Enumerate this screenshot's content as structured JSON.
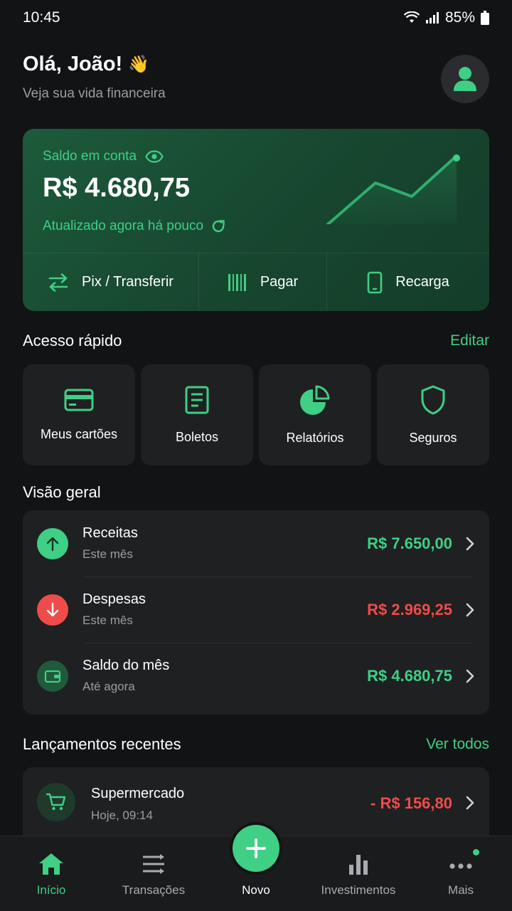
{
  "status_bar": {
    "time": "10:45",
    "battery": "85%"
  },
  "header": {
    "greeting": "Olá, João!",
    "emoji": "👋",
    "subtitle": "Veja sua vida financeira"
  },
  "balance": {
    "label": "Saldo em conta",
    "value": "R$ 4.680,75",
    "updated": "Atualizado agora há pouco",
    "actions": [
      {
        "label": "Pix / Transferir",
        "icon": "transfer-arrows-icon"
      },
      {
        "label": "Pagar",
        "icon": "barcode-icon"
      },
      {
        "label": "Recarga",
        "icon": "phone-icon"
      }
    ]
  },
  "quick_access": {
    "title": "Acesso rápido",
    "edit": "Editar",
    "tiles": [
      {
        "label": "Meus cartões",
        "icon": "credit-card-icon"
      },
      {
        "label": "Boletos",
        "icon": "document-icon"
      },
      {
        "label": "Relatórios",
        "icon": "pie-chart-icon"
      },
      {
        "label": "Seguros",
        "icon": "shield-icon"
      }
    ]
  },
  "overview": {
    "title": "Visão geral",
    "rows": [
      {
        "title": "Receitas",
        "sub": "Este mês",
        "value": "R$ 7.650,00",
        "color": "#3fcf85",
        "icon": "arrow-up-icon"
      },
      {
        "title": "Despesas",
        "sub": "Este mês",
        "value": "R$ 2.969,25",
        "color": "#f04b4b",
        "icon": "arrow-down-icon"
      },
      {
        "title": "Saldo do mês",
        "sub": "Até agora",
        "value": "R$ 4.680,75",
        "color": "#3fcf85",
        "icon": "wallet-icon"
      }
    ]
  },
  "recent": {
    "title": "Lançamentos recentes",
    "see_all": "Ver todos",
    "items": [
      {
        "title": "Supermercado",
        "sub": "Hoje, 09:14",
        "value": "- R$ 156,80",
        "icon": "cart-icon"
      }
    ]
  },
  "nav": {
    "items": [
      {
        "label": "Início",
        "icon": "home-icon"
      },
      {
        "label": "Transações",
        "icon": "transactions-icon"
      },
      {
        "label": "Novo",
        "icon": "plus-icon"
      },
      {
        "label": "Investimentos",
        "icon": "bar-chart-icon"
      },
      {
        "label": "Mais",
        "icon": "more-icon"
      }
    ]
  },
  "colors": {
    "accent": "#3fcf85",
    "negative": "#f04b4b",
    "background": "#121314",
    "card": "#1f2022"
  }
}
